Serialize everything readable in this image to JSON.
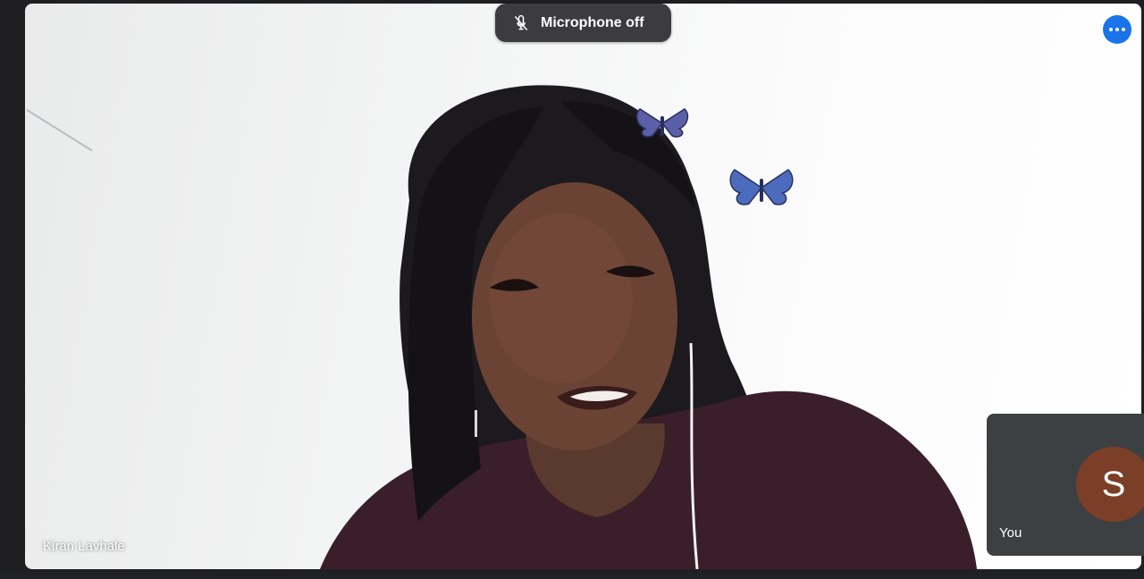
{
  "call": {
    "mic_status_text": "Microphone off",
    "mic_icon": "mic-off-icon",
    "more_options_icon": "more-horiz-icon",
    "accent_color": "#1a73e8"
  },
  "main_participant": {
    "name": "Kiran Lavhale"
  },
  "self_tile": {
    "avatar_initial": "S",
    "label": "You",
    "avatar_color": "#7b3f28",
    "tile_color": "#3c4043"
  }
}
